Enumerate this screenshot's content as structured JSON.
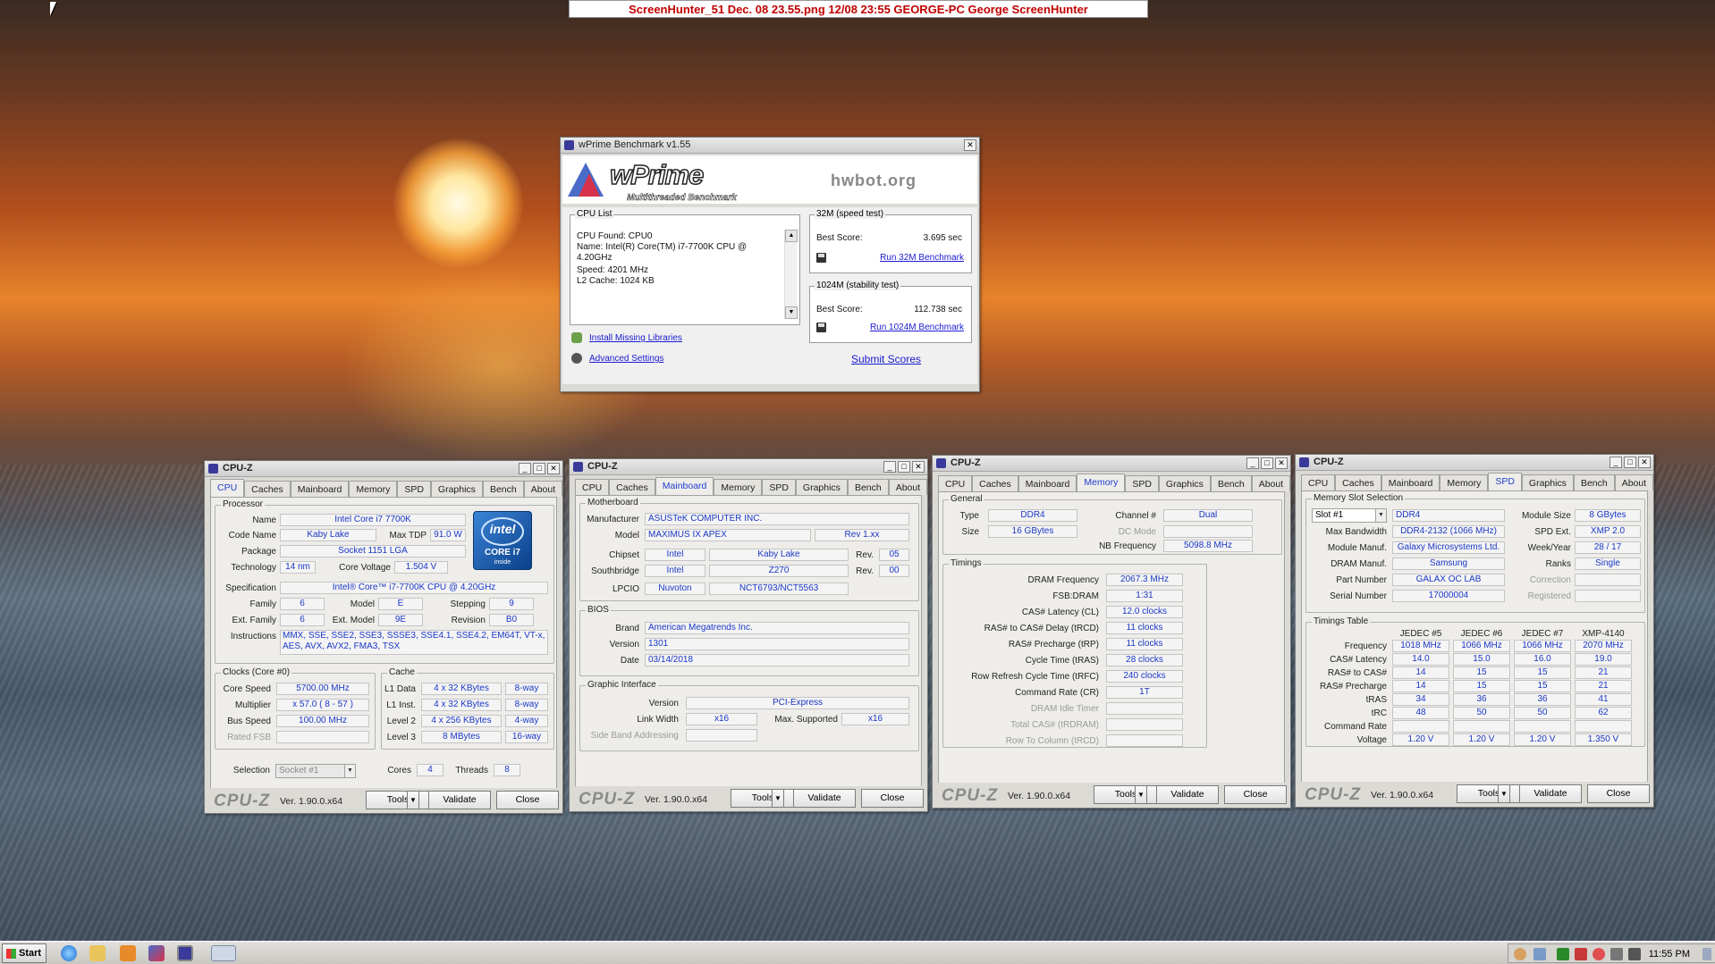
{
  "banner": "ScreenHunter_51 Dec. 08 23.55.png   12/08   23:55   GEORGE-PC  George  ScreenHunter",
  "wprime": {
    "title": "wPrime Benchmark v1.55",
    "logo_name": "wPrime",
    "logo_sub": "Multithreaded Benchmark",
    "hwbot": "hwbot.org",
    "cpu_list_title": "CPU List",
    "cpu_list_lines": [
      "CPU Found: CPU0",
      "Name:   Intel(R) Core(TM) i7-7700K CPU @",
      "4.20GHz",
      "Speed:   4201 MHz",
      "L2 Cache: 1024 KB"
    ],
    "test32_title": "32M (speed test)",
    "test32_label": "Best Score:",
    "test32_value": "3.695 sec",
    "test32_link": "Run 32M Benchmark",
    "test1024_title": "1024M (stability test)",
    "test1024_label": "Best Score:",
    "test1024_value": "112.738 sec",
    "test1024_link": "Run 1024M Benchmark",
    "install_link": "Install Missing Libraries",
    "adv_link": "Advanced Settings",
    "submit_link": "Submit Scores"
  },
  "cpuz_common": {
    "title": "CPU-Z",
    "tabs": [
      "CPU",
      "Caches",
      "Mainboard",
      "Memory",
      "SPD",
      "Graphics",
      "Bench",
      "About"
    ],
    "logo": "CPU-Z",
    "version": "Ver. 1.90.0.x64",
    "tools": "Tools",
    "validate": "Validate",
    "close": "Close"
  },
  "cpu": {
    "processor_title": "Processor",
    "name_label": "Name",
    "name": "Intel Core i7 7700K",
    "code_label": "Code Name",
    "code": "Kaby Lake",
    "tdp_label": "Max TDP",
    "tdp": "91.0 W",
    "package_label": "Package",
    "package": "Socket 1151 LGA",
    "tech_label": "Technology",
    "tech": "14 nm",
    "volt_label": "Core Voltage",
    "volt": "1.504 V",
    "spec_label": "Specification",
    "spec": "Intel® Core™ i7-7700K CPU @ 4.20GHz",
    "family_label": "Family",
    "family": "6",
    "model_label": "Model",
    "model": "E",
    "stepping_label": "Stepping",
    "stepping": "9",
    "extfam_label": "Ext. Family",
    "extfam": "6",
    "extmodel_label": "Ext. Model",
    "extmodel": "9E",
    "revision_label": "Revision",
    "revision": "B0",
    "instr_label": "Instructions",
    "instr": "MMX, SSE, SSE2, SSE3, SSSE3, SSE4.1, SSE4.2, EM64T, VT-x, AES, AVX, AVX2, FMA3, TSX",
    "intel_badge": [
      "intel",
      "CORE i7",
      "inside"
    ],
    "clocks_title": "Clocks (Core #0)",
    "corespeed_label": "Core Speed",
    "corespeed": "5700.00 MHz",
    "mult_label": "Multiplier",
    "mult": "x 57.0 ( 8 - 57 )",
    "bus_label": "Bus Speed",
    "bus": "100.00 MHz",
    "fsb_label": "Rated FSB",
    "cache_title": "Cache",
    "l1d_label": "L1 Data",
    "l1d": "4 x 32 KBytes",
    "l1d_way": "8-way",
    "l1i_label": "L1 Inst.",
    "l1i": "4 x 32 KBytes",
    "l1i_way": "8-way",
    "l2_label": "Level 2",
    "l2": "4 x 256 KBytes",
    "l2_way": "4-way",
    "l3_label": "Level 3",
    "l3": "8 MBytes",
    "l3_way": "16-way",
    "selection_label": "Selection",
    "selection": "Socket #1",
    "cores_label": "Cores",
    "cores": "4",
    "threads_label": "Threads",
    "threads": "8"
  },
  "mainboard": {
    "mb_title": "Motherboard",
    "manuf_label": "Manufacturer",
    "manuf": "ASUSTeK COMPUTER INC.",
    "model_label": "Model",
    "model": "MAXIMUS IX APEX",
    "model_rev": "Rev 1.xx",
    "chipset_label": "Chipset",
    "chipset_v": "Intel",
    "chipset_n": "Kaby Lake",
    "chipset_rev_label": "Rev.",
    "chipset_rev": "05",
    "south_label": "Southbridge",
    "south_v": "Intel",
    "south_n": "Z270",
    "south_rev_label": "Rev.",
    "south_rev": "00",
    "lpcio_label": "LPCIO",
    "lpcio_v": "Nuvoton",
    "lpcio_n": "NCT6793/NCT5563",
    "bios_title": "BIOS",
    "brand_label": "Brand",
    "brand": "American Megatrends Inc.",
    "version_label": "Version",
    "version": "1301",
    "date_label": "Date",
    "date": "03/14/2018",
    "gi_title": "Graphic Interface",
    "gi_version_label": "Version",
    "gi_version": "PCI-Express",
    "gi_width_label": "Link Width",
    "gi_width": "x16",
    "gi_max_label": "Max. Supported",
    "gi_max": "x16",
    "gi_sba_label": "Side Band Addressing"
  },
  "memory": {
    "general_title": "General",
    "type_label": "Type",
    "type": "DDR4",
    "channel_label": "Channel #",
    "channel": "Dual",
    "size_label": "Size",
    "size": "16 GBytes",
    "dcmode_label": "DC Mode",
    "nbfreq_label": "NB Frequency",
    "nbfreq": "5098.8 MHz",
    "timings_title": "Timings",
    "rows": [
      {
        "label": "DRAM Frequency",
        "value": "2067.3 MHz",
        "dim": false
      },
      {
        "label": "FSB:DRAM",
        "value": "1:31",
        "dim": false
      },
      {
        "label": "CAS# Latency (CL)",
        "value": "12.0 clocks",
        "dim": false
      },
      {
        "label": "RAS# to CAS# Delay (tRCD)",
        "value": "11 clocks",
        "dim": false
      },
      {
        "label": "RAS# Precharge (tRP)",
        "value": "11 clocks",
        "dim": false
      },
      {
        "label": "Cycle Time (tRAS)",
        "value": "28 clocks",
        "dim": false
      },
      {
        "label": "Row Refresh Cycle Time (tRFC)",
        "value": "240 clocks",
        "dim": false
      },
      {
        "label": "Command Rate (CR)",
        "value": "1T",
        "dim": false
      },
      {
        "label": "DRAM Idle Timer",
        "value": "",
        "dim": true
      },
      {
        "label": "Total CAS# (tRDRAM)",
        "value": "",
        "dim": true
      },
      {
        "label": "Row To Column (tRCD)",
        "value": "",
        "dim": true
      }
    ]
  },
  "spd": {
    "slot_title": "Memory Slot Selection",
    "slot": "Slot #1",
    "type": "DDR4",
    "modsize_label": "Module Size",
    "modsize": "8 GBytes",
    "maxbw_label": "Max Bandwidth",
    "maxbw": "DDR4-2132 (1066 MHz)",
    "spdext_label": "SPD Ext.",
    "spdext": "XMP 2.0",
    "modmanuf_label": "Module Manuf.",
    "modmanuf": "Galaxy Microsystems Ltd.",
    "week_label": "Week/Year",
    "week": "28 / 17",
    "drammanuf_label": "DRAM Manuf.",
    "drammanuf": "Samsung",
    "ranks_label": "Ranks",
    "ranks": "Single",
    "part_label": "Part Number",
    "part": "GALAX OC LAB",
    "corr_label": "Correction",
    "serial_label": "Serial Number",
    "serial": "17000004",
    "reg_label": "Registered",
    "table_title": "Timings Table",
    "columns": [
      "JEDEC #5",
      "JEDEC #6",
      "JEDEC #7",
      "XMP-4140"
    ],
    "rows": [
      {
        "label": "Frequency",
        "values": [
          "1018 MHz",
          "1066 MHz",
          "1066 MHz",
          "2070 MHz"
        ]
      },
      {
        "label": "CAS# Latency",
        "values": [
          "14.0",
          "15.0",
          "16.0",
          "19.0"
        ]
      },
      {
        "label": "RAS# to CAS#",
        "values": [
          "14",
          "15",
          "15",
          "21"
        ]
      },
      {
        "label": "RAS# Precharge",
        "values": [
          "14",
          "15",
          "15",
          "21"
        ]
      },
      {
        "label": "tRAS",
        "values": [
          "34",
          "36",
          "36",
          "41"
        ]
      },
      {
        "label": "tRC",
        "values": [
          "48",
          "50",
          "50",
          "62"
        ]
      },
      {
        "label": "Command Rate",
        "values": [
          "",
          "",
          "",
          ""
        ]
      },
      {
        "label": "Voltage",
        "values": [
          "1.20 V",
          "1.20 V",
          "1.20 V",
          "1.350 V"
        ]
      }
    ]
  },
  "taskbar": {
    "start": "Start",
    "clock": "11:55 PM"
  }
}
